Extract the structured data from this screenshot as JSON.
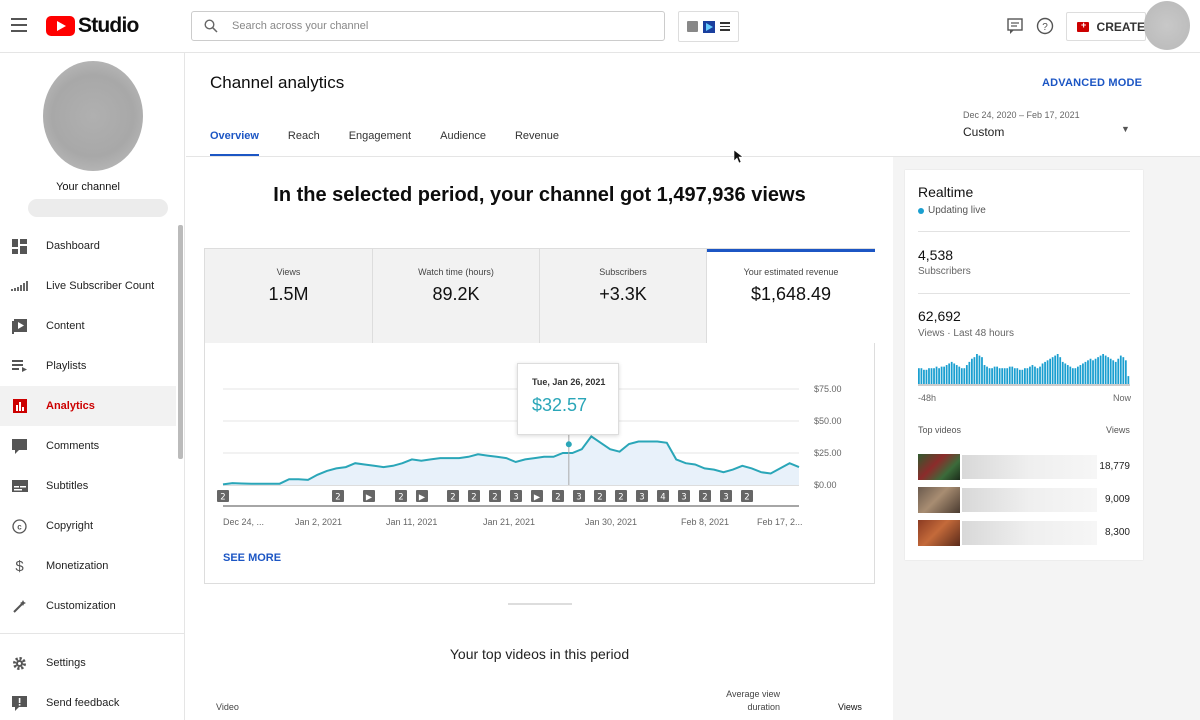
{
  "app": {
    "logo_text": "Studio"
  },
  "search": {
    "placeholder": "Search across your channel"
  },
  "toolbar": {
    "create_label": "CREATE"
  },
  "sidebar": {
    "channel_label": "Your channel",
    "items": [
      {
        "label": "Dashboard",
        "icon": "dashboard-icon"
      },
      {
        "label": "Live Subscriber Count",
        "icon": "signal-bars-icon"
      },
      {
        "label": "Content",
        "icon": "content-icon"
      },
      {
        "label": "Playlists",
        "icon": "playlist-icon"
      },
      {
        "label": "Analytics",
        "icon": "analytics-icon"
      },
      {
        "label": "Comments",
        "icon": "comment-icon"
      },
      {
        "label": "Subtitles",
        "icon": "subtitles-icon"
      },
      {
        "label": "Copyright",
        "icon": "copyright-icon"
      },
      {
        "label": "Monetization",
        "icon": "dollar-icon"
      },
      {
        "label": "Customization",
        "icon": "magic-wand-icon"
      },
      {
        "label": "Settings",
        "icon": "gear-icon"
      },
      {
        "label": "Send feedback",
        "icon": "feedback-icon"
      }
    ],
    "active_label": "Analytics"
  },
  "page": {
    "title": "Channel analytics",
    "advanced_mode": "ADVANCED MODE",
    "tabs": [
      "Overview",
      "Reach",
      "Engagement",
      "Audience",
      "Revenue"
    ],
    "active_tab": "Overview",
    "date_range": "Dec 24, 2020 – Feb 17, 2021",
    "date_preset": "Custom",
    "headline": "In the selected period, your channel got 1,497,936 views"
  },
  "metrics": [
    {
      "label": "Views",
      "value": "1.5M"
    },
    {
      "label": "Watch time (hours)",
      "value": "89.2K"
    },
    {
      "label": "Subscribers",
      "value": "+3.3K"
    },
    {
      "label": "Your estimated revenue",
      "value": "$1,648.49"
    }
  ],
  "tooltip": {
    "date": "Tue, Jan 26, 2021",
    "value": "$32.57"
  },
  "see_more": "SEE MORE",
  "chart_data": {
    "type": "area",
    "series": [
      {
        "values": [
          0.5,
          1.5,
          1.2,
          1.0,
          1.0,
          1.0,
          1.0,
          4.5,
          4.5,
          4.0,
          8.0,
          11,
          13,
          14,
          17,
          16,
          15,
          14,
          15,
          17,
          20,
          19,
          20,
          21,
          21,
          21,
          22,
          24,
          23,
          22,
          21,
          18,
          20,
          21,
          22,
          22,
          25,
          25,
          28,
          38,
          33,
          28,
          26,
          32,
          34,
          34,
          34,
          33,
          20,
          17,
          16,
          13,
          12,
          10,
          12,
          15,
          13,
          10,
          9,
          13,
          17,
          14
        ]
      }
    ],
    "x_tick_labels": [
      "Dec 24, ...",
      "Jan 2, 2021",
      "Jan 11, 2021",
      "Jan 21, 2021",
      "Jan 30, 2021",
      "Feb 8, 2021",
      "Feb 17, 2..."
    ],
    "y_tick_labels": [
      "$75.00",
      "$50.00",
      "$25.00",
      "$0.00"
    ],
    "ylim": [
      0,
      75
    ],
    "highlight": {
      "label": "Tue, Jan 26, 2021",
      "value": 32.57
    },
    "markers": [
      "2",
      "2",
      "▶",
      "2",
      "▶",
      "2",
      "2",
      "2",
      "3",
      "▶",
      "2",
      "3",
      "2",
      "2",
      "3",
      "4",
      "3",
      "2",
      "3",
      "2"
    ],
    "colors": {
      "line": "#2aa6b8",
      "fill": "#e8f1fa"
    }
  },
  "top_videos_section": {
    "title": "Your top videos in this period",
    "col_video": "Video",
    "col_avg": "Average view duration",
    "col_views": "Views"
  },
  "realtime": {
    "title": "Realtime",
    "status": "Updating live",
    "subscribers_value": "4,538",
    "subscribers_label": "Subscribers",
    "views_value": "62,692",
    "views_label": "Views · Last 48 hours",
    "axis_start": "-48h",
    "axis_end": "Now",
    "top_videos_label": "Top videos",
    "views_col_label": "Views",
    "videos": [
      {
        "views": "18,779"
      },
      {
        "views": "9,009"
      },
      {
        "views": "8,300"
      }
    ],
    "bars": [
      10,
      10,
      9,
      9,
      10,
      10,
      10,
      11,
      10,
      11,
      11,
      12,
      13,
      14,
      13,
      12,
      11,
      10,
      10,
      12,
      14,
      16,
      17,
      19,
      18,
      17,
      12,
      11,
      10,
      10,
      11,
      11,
      10,
      10,
      10,
      10,
      11,
      11,
      10,
      10,
      9,
      9,
      10,
      10,
      11,
      12,
      11,
      10,
      11,
      13,
      14,
      15,
      16,
      17,
      18,
      19,
      17,
      14,
      13,
      12,
      11,
      10,
      10,
      11,
      12,
      13,
      14,
      15,
      16,
      15,
      16,
      17,
      18,
      19,
      18,
      17,
      16,
      15,
      14,
      16,
      18,
      17,
      15,
      5
    ]
  },
  "colors": {
    "accent": "#1c56c4",
    "brand_red": "#ff0000",
    "active_nav": "#cc0000",
    "realtime_bar": "#1a9fd0"
  }
}
